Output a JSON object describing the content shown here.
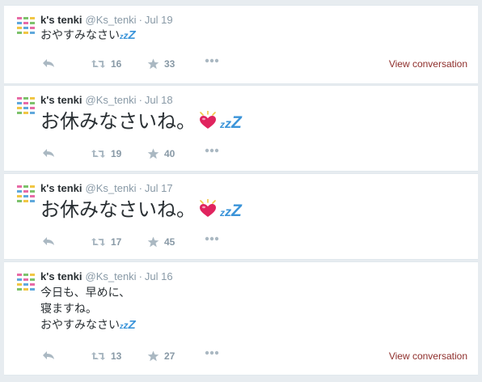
{
  "colors": {
    "link": "#8e2e2b",
    "muted": "#8899a6",
    "heart": "#e0245e",
    "zzz": "#3b94d9"
  },
  "tweets": [
    {
      "fullname": "k's tenki",
      "username": "@Ks_tenki",
      "separator": "·",
      "time": "Jul 19",
      "lines": [
        "おやすみなさい"
      ],
      "retweets": "16",
      "favorites": "33",
      "view_conversation": "View conversation"
    },
    {
      "fullname": "k's tenki",
      "username": "@Ks_tenki",
      "separator": "·",
      "time": "Jul 18",
      "lines": [
        "お休みなさいね。"
      ],
      "retweets": "19",
      "favorites": "40"
    },
    {
      "fullname": "k's tenki",
      "username": "@Ks_tenki",
      "separator": "·",
      "time": "Jul 17",
      "lines": [
        "お休みなさいね。"
      ],
      "retweets": "17",
      "favorites": "45"
    },
    {
      "fullname": "k's tenki",
      "username": "@Ks_tenki",
      "separator": "·",
      "time": "Jul 16",
      "lines": [
        "今日も、早めに、",
        "寝ますね。",
        "おやすみなさい"
      ],
      "retweets": "13",
      "favorites": "27",
      "view_conversation": "View conversation"
    }
  ],
  "icons": {
    "reply": "reply-icon",
    "retweet": "retweet-icon",
    "favorite": "star-icon",
    "more": "more-icon",
    "heart": "heart-emoji-icon",
    "zzz": "zzz-emoji-icon"
  }
}
